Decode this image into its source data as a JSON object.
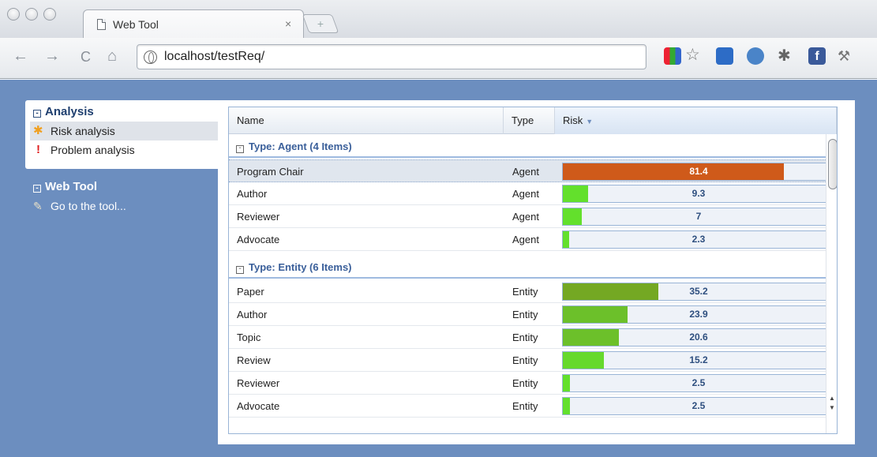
{
  "browser": {
    "tab_title": "Web Tool",
    "tab_close": "×",
    "new_tab": "+",
    "url": "localhost/testReq/",
    "nav": {
      "back": "←",
      "forward": "→",
      "reload": "C",
      "home": "⌂"
    }
  },
  "sidebar": {
    "analysis": {
      "heading": "Analysis",
      "items": [
        {
          "label": "Risk analysis",
          "icon": "risk-icon",
          "icon_glyph": "✱"
        },
        {
          "label": "Problem analysis",
          "icon": "exclamation-icon",
          "icon_glyph": "!"
        }
      ]
    },
    "tool": {
      "heading": "Web Tool",
      "items": [
        {
          "label": "Go to the tool...",
          "icon": "wrench-icon",
          "icon_glyph": "🔧"
        }
      ]
    }
  },
  "grid": {
    "columns": {
      "name": "Name",
      "type": "Type",
      "risk": "Risk"
    },
    "groups": [
      {
        "label": "Type: Agent (4 Items)",
        "rows": [
          {
            "name": "Program Chair",
            "type": "Agent",
            "risk": 81.4,
            "risk_label": "81.4",
            "color": "#cf5a1a",
            "selected": true
          },
          {
            "name": "Author",
            "type": "Agent",
            "risk": 9.3,
            "risk_label": "9.3",
            "color": "#63e02c"
          },
          {
            "name": "Reviewer",
            "type": "Agent",
            "risk": 7,
            "risk_label": "7",
            "color": "#63e02c"
          },
          {
            "name": "Advocate",
            "type": "Agent",
            "risk": 2.3,
            "risk_label": "2.3",
            "color": "#63e02c"
          }
        ]
      },
      {
        "label": "Type: Entity (6 Items)",
        "rows": [
          {
            "name": "Paper",
            "type": "Entity",
            "risk": 35.2,
            "risk_label": "35.2",
            "color": "#74a823"
          },
          {
            "name": "Author",
            "type": "Entity",
            "risk": 23.9,
            "risk_label": "23.9",
            "color": "#6cc02a"
          },
          {
            "name": "Topic",
            "type": "Entity",
            "risk": 20.6,
            "risk_label": "20.6",
            "color": "#6cc02a"
          },
          {
            "name": "Review",
            "type": "Entity",
            "risk": 15.2,
            "risk_label": "15.2",
            "color": "#66d92c"
          },
          {
            "name": "Reviewer",
            "type": "Entity",
            "risk": 2.5,
            "risk_label": "2.5",
            "color": "#63e02c"
          },
          {
            "name": "Advocate",
            "type": "Entity",
            "risk": 2.5,
            "risk_label": "2.5",
            "color": "#63e02c"
          }
        ]
      }
    ]
  }
}
